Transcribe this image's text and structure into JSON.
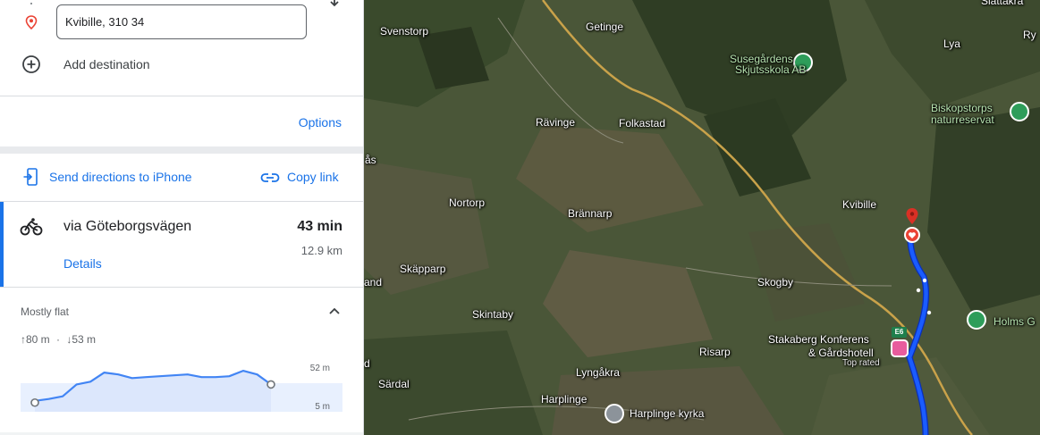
{
  "directions": {
    "destination_value": "Kvibille, 310 34",
    "add_destination_label": "Add destination",
    "options_label": "Options",
    "send_label": "Send directions to iPhone",
    "copy_label": "Copy link"
  },
  "route": {
    "mode_icon": "bicycle-icon",
    "via": "via Göteborgsvägen",
    "duration": "43 min",
    "distance": "12.9 km",
    "details_label": "Details"
  },
  "elevation": {
    "title": "Mostly flat",
    "ascent": "80 m",
    "descent": "53 m",
    "separator": "·",
    "max_label": "52 m",
    "min_label": "5 m",
    "profile": [
      12,
      14,
      17,
      30,
      33,
      43,
      41,
      37,
      38,
      39,
      40,
      41,
      38,
      38,
      39,
      45,
      41,
      30
    ]
  },
  "map": {
    "places": [
      "Svenstorp",
      "Getinge",
      "Susegårdens",
      "Skjutsskola AB",
      "Lya",
      "Ry",
      "Biskopstorps",
      "naturreservat",
      "Rävinge",
      "Folkastad",
      "Kvibille",
      "Nortorp",
      "Brännarp",
      "Skäpparp",
      "Skogby",
      "Skintaby",
      "Holms G",
      "Stakaberg Konferens",
      "& Gårdshotell",
      "Top rated",
      "Risarp",
      "Lyngåkra",
      "Harplinge",
      "Särdal",
      "Harplinge kyrka",
      "Slättakra",
      "ås",
      "and",
      "d"
    ],
    "road_badge": "E6",
    "accent_colors": {
      "route": "#1a5cff",
      "marker": "#ea4335",
      "hotel": "#e85c9d",
      "park": "#2e9d5a"
    }
  }
}
